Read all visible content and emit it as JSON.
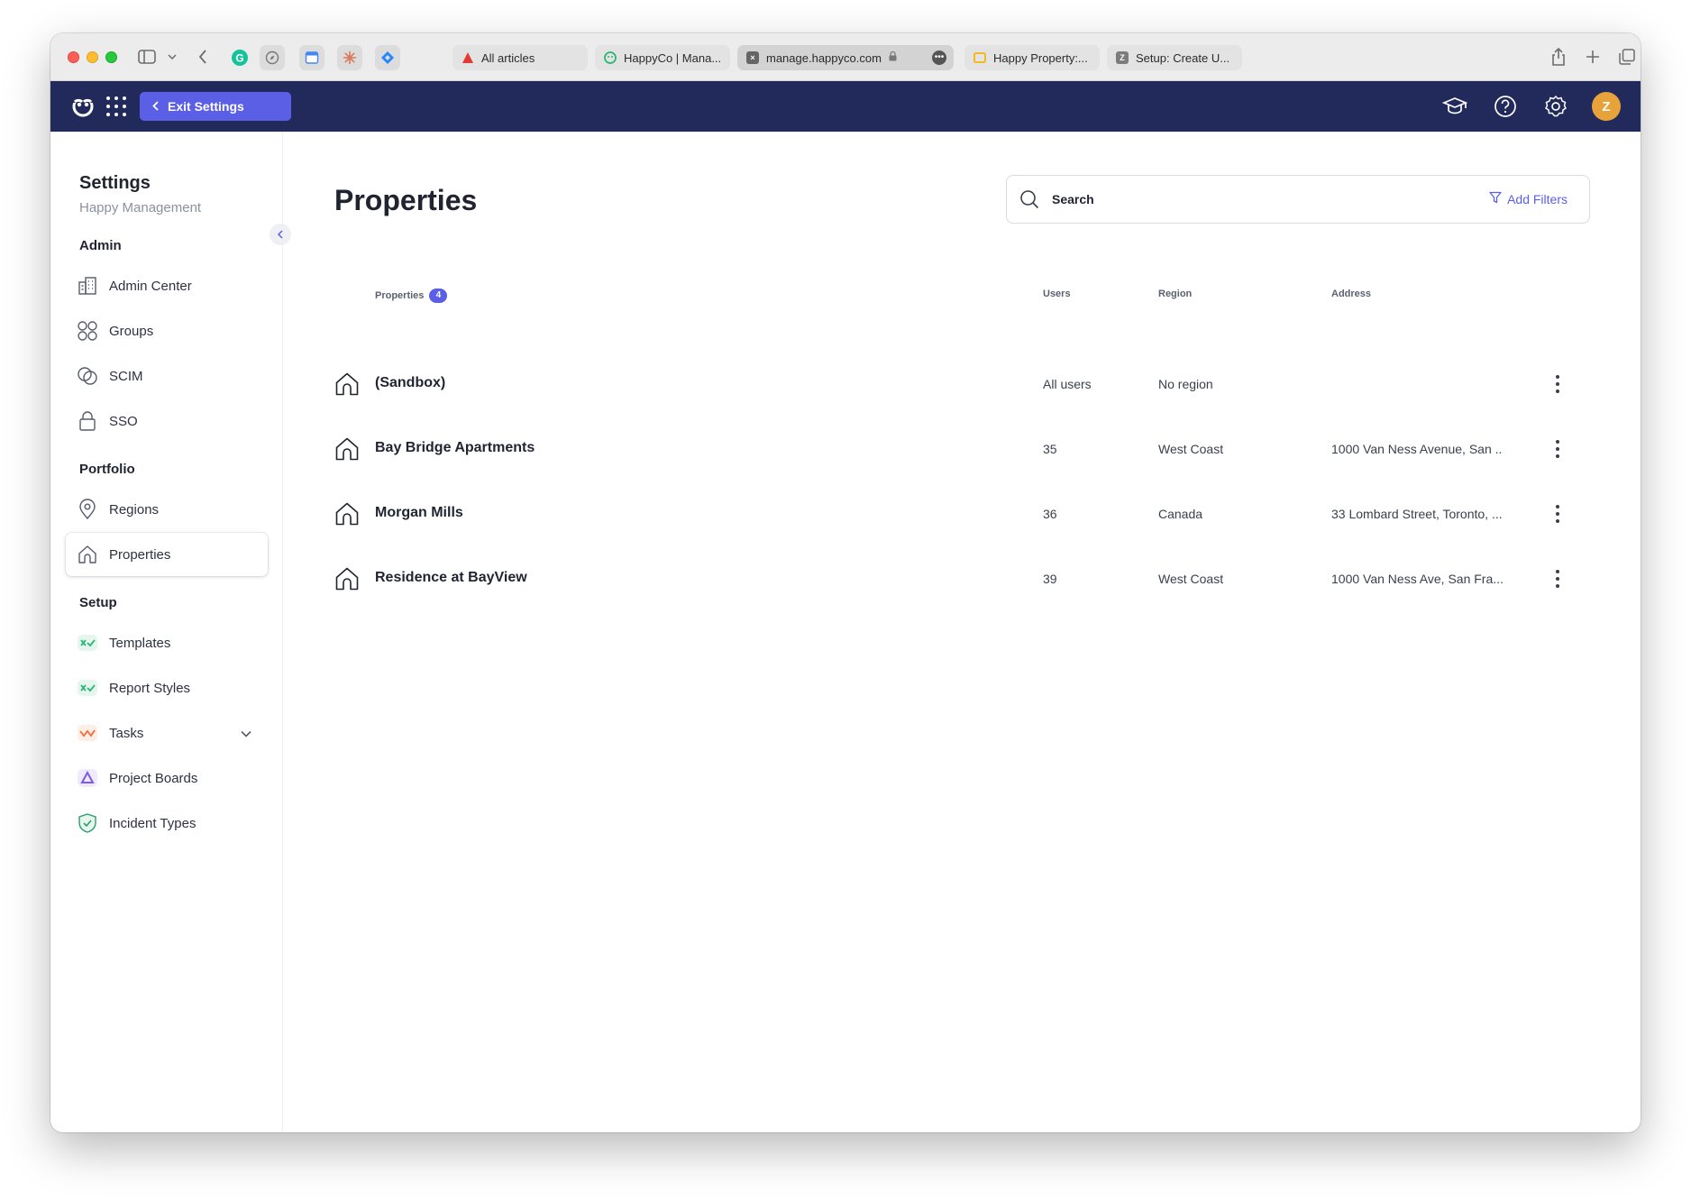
{
  "browser": {
    "tabs": [
      {
        "label": "All articles",
        "favicon_color": "#e23b2f"
      },
      {
        "label": "HappyCo | Mana...",
        "favicon_color": "#2bb673"
      },
      {
        "label": "manage.happyco.com",
        "favicon_color": "#666666",
        "active": true
      },
      {
        "label": "Happy Property:...",
        "favicon_color": "#f2b705"
      },
      {
        "label": "Setup: Create U...",
        "favicon_color": "#7c7c7c"
      }
    ]
  },
  "header": {
    "exit_label": "Exit Settings",
    "avatar_initial": "Z",
    "brand_color": "#222a5c",
    "accent_color": "#5b5fe6"
  },
  "sidebar": {
    "title": "Settings",
    "subtitle": "Happy Management",
    "sections": {
      "admin": "Admin",
      "portfolio": "Portfolio",
      "setup": "Setup"
    },
    "admin_items": [
      {
        "label": "Admin Center",
        "icon": "building-icon"
      },
      {
        "label": "Groups",
        "icon": "groups-icon"
      },
      {
        "label": "SCIM",
        "icon": "scim-icon"
      },
      {
        "label": "SSO",
        "icon": "lock-icon"
      }
    ],
    "portfolio_items": [
      {
        "label": "Regions",
        "icon": "map-pin-icon"
      },
      {
        "label": "Properties",
        "icon": "home-icon",
        "active": true
      }
    ],
    "setup_items": [
      {
        "label": "Templates",
        "icon": "templates-icon"
      },
      {
        "label": "Report Styles",
        "icon": "report-styles-icon"
      },
      {
        "label": "Tasks",
        "icon": "tasks-icon"
      },
      {
        "label": "Project Boards",
        "icon": "project-boards-icon"
      },
      {
        "label": "Incident Types",
        "icon": "shield-check-icon"
      }
    ]
  },
  "main": {
    "title": "Properties",
    "search_placeholder": "Search",
    "add_filters_label": "Add Filters",
    "columns": {
      "properties": "Properties",
      "count": "4",
      "users": "Users",
      "region": "Region",
      "address": "Address"
    },
    "rows": [
      {
        "name": "(Sandbox)",
        "users": "All users",
        "region": "No region",
        "address": ""
      },
      {
        "name": "Bay Bridge Apartments",
        "users": "35",
        "region": "West Coast",
        "address": "1000 Van Ness Avenue, San ..."
      },
      {
        "name": "Morgan Mills",
        "users": "36",
        "region": "Canada",
        "address": "33 Lombard Street, Toronto, ..."
      },
      {
        "name": "Residence at BayView",
        "users": "39",
        "region": "West Coast",
        "address": "1000 Van Ness Ave, San Fra..."
      }
    ]
  }
}
